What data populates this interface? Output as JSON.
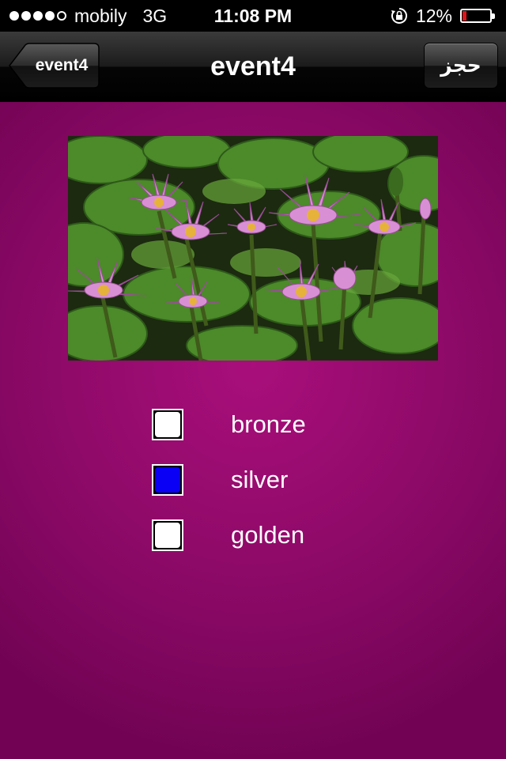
{
  "status_bar": {
    "carrier": "mobily",
    "network": "3G",
    "time": "11:08 PM",
    "battery": "12%",
    "signal_bars": [
      true,
      true,
      true,
      true,
      false
    ],
    "icons": [
      "rotation-lock-icon",
      "battery-icon"
    ],
    "battery_color": "#e0141a"
  },
  "nav": {
    "title": "event4",
    "back_label": "event4",
    "right_button_label": "حجز"
  },
  "content": {
    "background_color": "#8f0a69",
    "image_subject": "water lilies",
    "options": [
      {
        "label": "bronze",
        "checked": false
      },
      {
        "label": "silver",
        "checked": true
      },
      {
        "label": "golden",
        "checked": false
      }
    ],
    "checked_color": "#0a00f5"
  }
}
